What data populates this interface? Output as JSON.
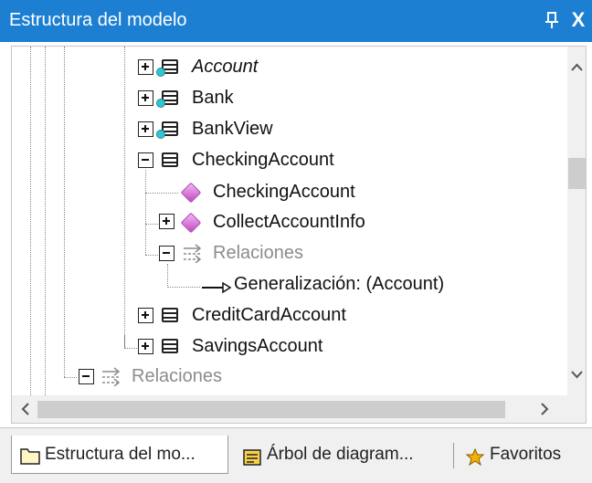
{
  "window": {
    "title": "Estructura del modelo",
    "pin_icon": "pin-icon",
    "close_label": "X"
  },
  "tree": {
    "items": [
      {
        "label": "Account",
        "icon": "class-icon-with-dot",
        "expanded": false,
        "italic": true
      },
      {
        "label": "Bank",
        "icon": "class-icon-with-dot",
        "expanded": false
      },
      {
        "label": "BankView",
        "icon": "class-icon-with-dot",
        "expanded": false
      },
      {
        "label": "CheckingAccount",
        "icon": "class-icon",
        "expanded": true
      },
      {
        "label": "CheckingAccount",
        "icon": "operation-diamond-icon"
      },
      {
        "label": "CollectAccountInfo",
        "icon": "operation-diamond-icon",
        "expanded": false
      },
      {
        "label": "Relaciones",
        "icon": "relations-icon",
        "expanded": true,
        "muted": true
      },
      {
        "label": "Generalización:  (Account)",
        "icon": "generalization-arrow-icon"
      },
      {
        "label": "CreditCardAccount",
        "icon": "class-icon",
        "expanded": false
      },
      {
        "label": "SavingsAccount",
        "icon": "class-icon",
        "expanded": false
      },
      {
        "label": "Relaciones",
        "icon": "relations-icon",
        "expanded": true,
        "muted": true
      }
    ]
  },
  "scrollbars": {
    "vertical": {
      "up_label": "^",
      "down_label": "v"
    },
    "horizontal": {
      "left_label": "<",
      "right_label": ">"
    }
  },
  "tabs": [
    {
      "label": "Estructura del mo...",
      "icon": "folder-icon",
      "active": true
    },
    {
      "label": "Árbol de diagram...",
      "icon": "diagram-tree-icon",
      "active": false
    },
    {
      "label": "Favoritos",
      "icon": "favorites-icon",
      "active": false
    }
  ],
  "colors": {
    "titlebar": "#1c7fd1",
    "class_dot": "#33c4cf",
    "operation": "#c247c4",
    "muted_text": "#8c8c8c"
  }
}
